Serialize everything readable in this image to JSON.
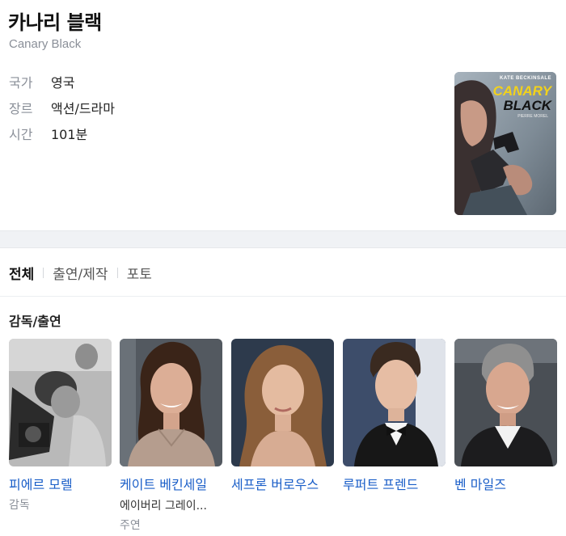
{
  "movie": {
    "title_ko": "카나리 블랙",
    "title_en": "Canary Black",
    "info": [
      {
        "label": "국가",
        "value": "영국"
      },
      {
        "label": "장르",
        "value": "액션/드라마"
      },
      {
        "label": "시간",
        "value": "101분"
      }
    ],
    "poster": {
      "actor_name": "KATE BECKINSALE",
      "title_line1": "CANARY",
      "title_line2": "BLACK",
      "small_text": "PIERRE MOREL"
    }
  },
  "tabs": [
    "전체",
    "출연/제작",
    "포토"
  ],
  "section_title": "감독/출연",
  "cast": [
    {
      "name": "피에르 모렐",
      "role": "감독",
      "character": ""
    },
    {
      "name": "케이트 베킨세일",
      "role": "주연",
      "character": "에이버리 그레이..."
    },
    {
      "name": "세프론 버로우스",
      "role": "",
      "character": ""
    },
    {
      "name": "루퍼트 프렌드",
      "role": "",
      "character": ""
    },
    {
      "name": "벤 마일즈",
      "role": "",
      "character": ""
    }
  ],
  "colors": {
    "link": "#1a5ec8",
    "muted": "#8a8f98",
    "poster_yellow": "#f2d21b"
  }
}
